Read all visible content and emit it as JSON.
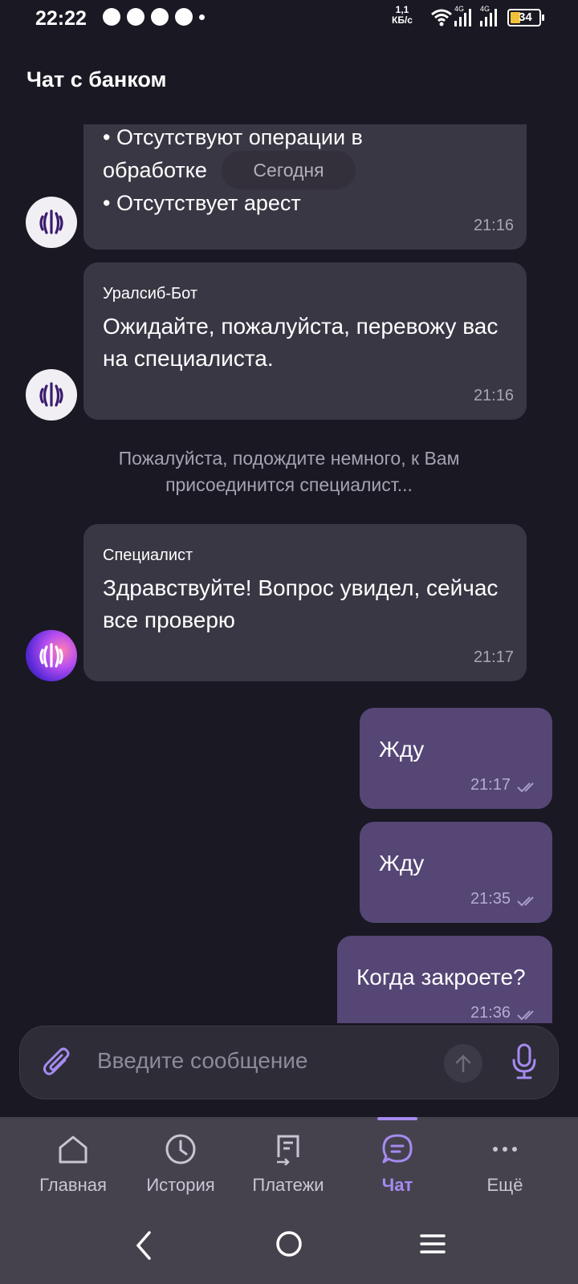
{
  "status_bar": {
    "time": "22:22",
    "speed_value": "1,1",
    "speed_unit": "КБ/с",
    "net1": "4G",
    "net2": "4G",
    "battery": "34"
  },
  "header": {
    "title": "Чат с банком"
  },
  "chat": {
    "date_chip": "Сегодня",
    "messages_in": [
      {
        "author": "",
        "lines": [
          "• Отсутствуют операции в",
          "обработке",
          "• Отсутствует арест"
        ],
        "time": "21:16"
      },
      {
        "author": "Уралсиб-Бот",
        "text": "Ожидайте, пожалуйста, перевожу вас на специалиста.",
        "time": "21:16"
      },
      {
        "author": "Специалист",
        "text": "Здравствуйте! Вопрос увидел, сейчас все проверю",
        "time": "21:17"
      }
    ],
    "system_note": "Пожалуйста, подождите немного, к Вам присоединится специалист...",
    "messages_out": [
      {
        "text": "Жду",
        "time": "21:17"
      },
      {
        "text": "Жду",
        "time": "21:35"
      },
      {
        "text": "Когда закроете?",
        "time": "21:36"
      }
    ]
  },
  "input": {
    "placeholder": "Введите сообщение"
  },
  "nav": {
    "items": [
      {
        "label": "Главная"
      },
      {
        "label": "История"
      },
      {
        "label": "Платежи"
      },
      {
        "label": "Чат"
      },
      {
        "label": "Ещё"
      }
    ],
    "active": "Чат",
    "accent": "#a58bf0"
  },
  "colors": {
    "background": "#1a1822",
    "incoming_bubble": "#3a3744",
    "outgoing_bubble": "#554676"
  }
}
